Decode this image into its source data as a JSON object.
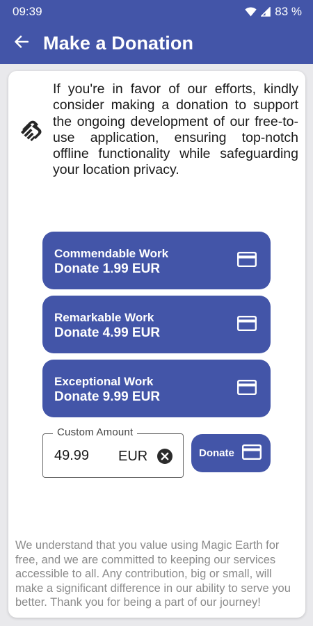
{
  "status_bar": {
    "time": "09:39",
    "battery": "83 %",
    "icons": [
      "wifi-icon",
      "signal-icon"
    ]
  },
  "toolbar": {
    "title": "Make a Donation",
    "back_icon": "back-arrow-icon"
  },
  "colors": {
    "primary": "#4355a8",
    "background": "#e9e9ec",
    "text": "#1a1a1a",
    "muted_text": "#8a8a8a"
  },
  "intro": {
    "icon": "handshake-icon",
    "text": "If you're in favor of our efforts, kindly consider making a donation to support the ongoing development of our free-to-use application, ensuring top-notch offline functionality while safeguarding your location privacy."
  },
  "options": [
    {
      "title": "Commendable Work",
      "price": "Donate 1.99 EUR",
      "icon": "credit-card-icon"
    },
    {
      "title": "Remarkable Work",
      "price": "Donate 4.99 EUR",
      "icon": "credit-card-icon"
    },
    {
      "title": "Exceptional Work",
      "price": "Donate 9.99 EUR",
      "icon": "credit-card-icon"
    }
  ],
  "custom": {
    "label": "Custom Amount",
    "value": "49.99",
    "currency": "EUR",
    "clear_icon": "clear-icon",
    "button_label": "Donate",
    "button_icon": "credit-card-icon"
  },
  "footer": {
    "text": "We understand that you value using Magic Earth for free, and we are committed to keeping our services accessible to all. Any contribution, big or small, will make a significant difference in our ability to serve you better. Thank you for being a part of our journey!"
  }
}
